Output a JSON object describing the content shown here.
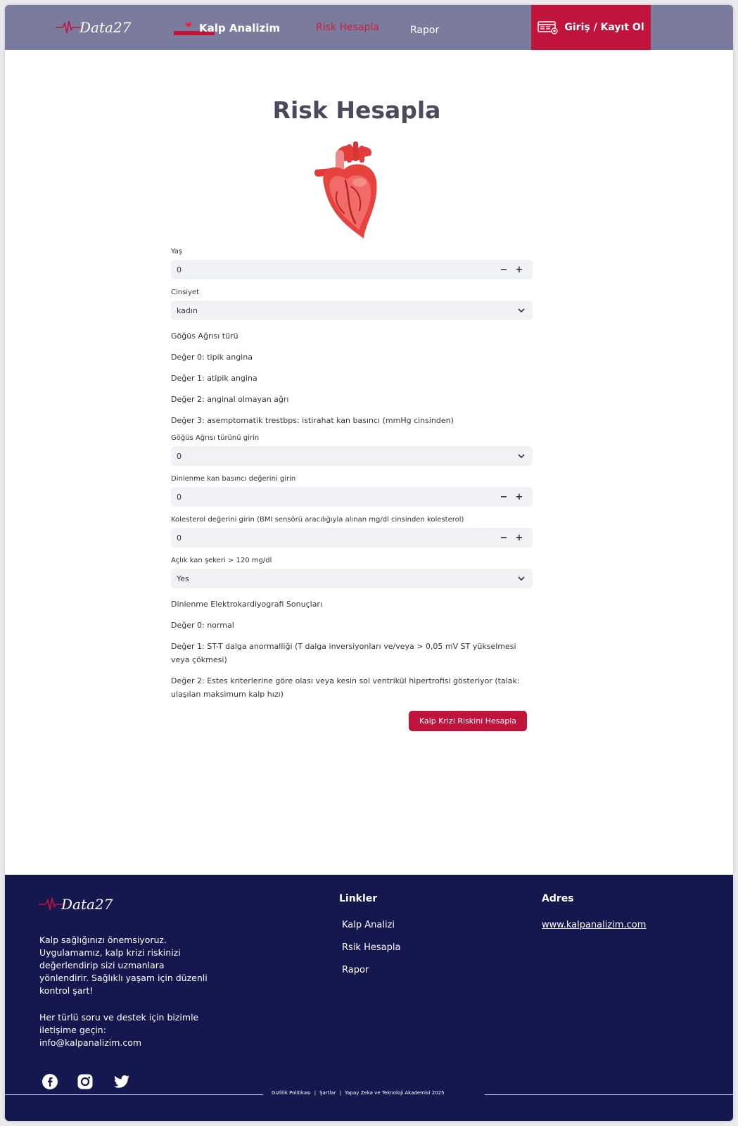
{
  "nav": {
    "logo_text": "Data27",
    "kalp_analizim": "Kalp Analizim",
    "risk_hesapla": "Risk Hesapla",
    "rapor": "Rapor",
    "login": "Giriş / Kayıt Ol",
    "icons": [
      "heart-emoji",
      "login-card-icon"
    ]
  },
  "page": {
    "title": "Risk Hesapla",
    "image": "anatomical-heart"
  },
  "form": {
    "age": {
      "label": "Yaş",
      "value": "0",
      "minus": "−",
      "plus": "+"
    },
    "gender": {
      "label": "Cinsiyet",
      "value": "kadın"
    },
    "chest_pain": {
      "title": "Göğüs Ağrısı türü",
      "lines": [
        "Değer 0: tipik angina",
        "Değer 1: atipik angina",
        "Değer 2: anginal olmayan ağrı",
        "Değer 3: asemptomatik trestbps: istirahat kan basıncı (mmHg cinsinden)"
      ],
      "input_label": "Göğüs Ağrısı türünü girin",
      "value": "0"
    },
    "blood_pressure": {
      "label": "Dinlenme kan basıncı değerini girin",
      "value": "0",
      "minus": "−",
      "plus": "+"
    },
    "cholesterol": {
      "label": "Kolesterol değerini girin (BMI sensörü aracılığıyla alınan mg/dl cinsinden kolesterol)",
      "value": "0",
      "minus": "−",
      "plus": "+"
    },
    "fasting_sugar": {
      "label": "Açlık kan şekeri > 120 mg/dl",
      "value": "Yes"
    },
    "ecg": {
      "title": "Dinlenme Elektrokardiyografi Sonuçları",
      "lines": [
        "Değer 0: normal",
        "Değer 1: ST-T dalga anormalliği (T dalga inversiyonları ve/veya > 0,05 mV ST yükselmesi veya çökmesi)",
        "Değer 2: Estes kriterlerine göre olası veya kesin sol ventrikül hipertrofisi gösteriyor (talak: ulaşılan maksimum kalp hızı)"
      ]
    },
    "submit": "Kalp Krizi Riskini Hesapla"
  },
  "footer": {
    "logo_text": "Data27",
    "description": "Kalp sağlığınızı önemsiyoruz. Uygulamamız, kalp krizi riskinizi değerlendirip sizi uzmanlara yönlendirir. Sağlıklı yaşam için düzenli kontrol şart!",
    "contact": "Her türlü soru ve destek için bizimle iletişime geçin: info@kalpanalizim.com",
    "links_title": "Linkler",
    "links": [
      "Kalp Analizi",
      "Rsik Hesapla",
      "Rapor"
    ],
    "address_title": "Adres",
    "address_url": "www.kalpanalizim.com",
    "bottom": {
      "privacy": "Gizlilik Politikası",
      "terms": "Şartlar",
      "academy": "Yapay Zeka ve Teknoloji Akademisi 2025",
      "separator": "|"
    },
    "socials": [
      "facebook",
      "instagram",
      "twitter"
    ]
  },
  "colors": {
    "nav_bg": "#7b7b9e",
    "accent": "#c0143c",
    "footer_bg": "#15174f",
    "input_bg": "#f0f2f6"
  }
}
